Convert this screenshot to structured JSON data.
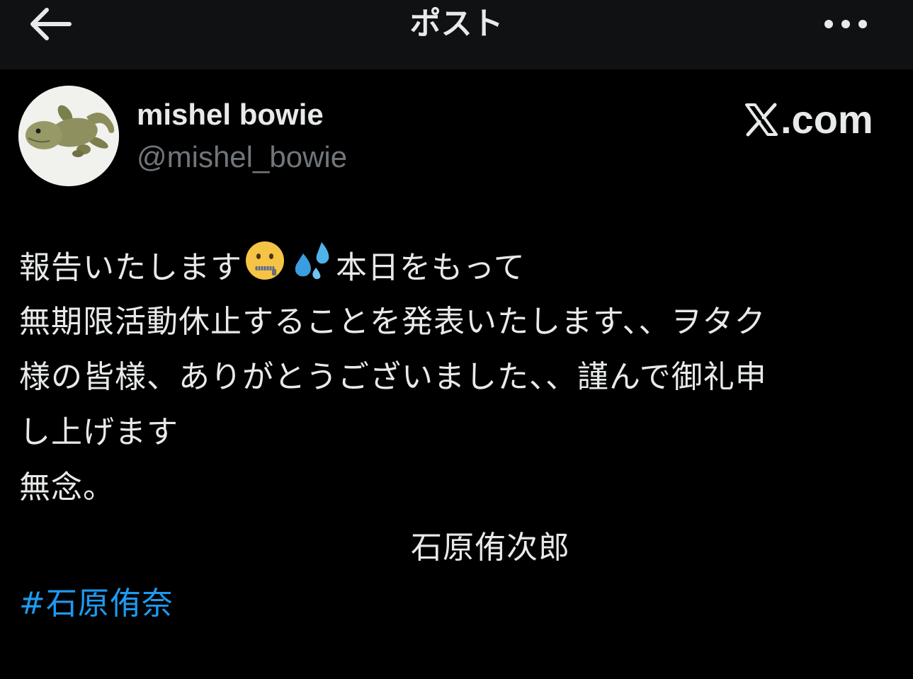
{
  "header": {
    "title": "ポスト",
    "back_icon": "arrow-left-icon",
    "more_icon": "more-horizontal-icon"
  },
  "author": {
    "display_name": "mishel bowie",
    "handle": "@mishel_bowie",
    "avatar_icon": "gecko-plush-avatar"
  },
  "brand": {
    "domain_text": ".com",
    "logo_icon": "x-logo-icon"
  },
  "post": {
    "line1_part1": "報告いたします",
    "emoji_1": "zipper-mouth-face-emoji",
    "emoji_2": "sweat-droplets-emoji",
    "line1_part2": "本日をもって",
    "line2": "無期限活動休止することを発表いたします、、ヲタク",
    "line3": "様の皆様、ありがとうございました、、謹んで御礼申",
    "line4": "し上げます",
    "line5": "無念。",
    "signature": "石原侑次郎",
    "hashtag": "#石原侑奈"
  },
  "colors": {
    "background": "#000000",
    "header_background": "#101113",
    "text_primary": "#e7e9ea",
    "text_secondary": "#71767b",
    "link": "#1d9bf0"
  }
}
